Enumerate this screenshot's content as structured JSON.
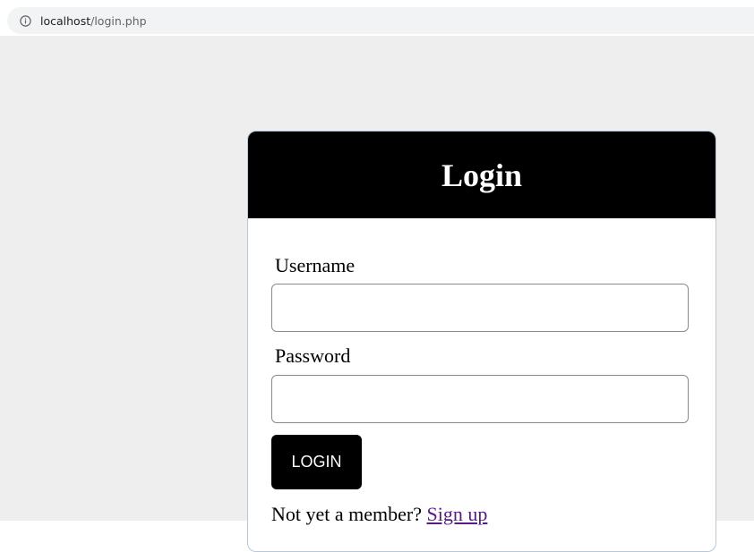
{
  "browser": {
    "url_host": "localhost",
    "url_path": "/login.php",
    "info_icon": "info-icon"
  },
  "login_form": {
    "title": "Login",
    "username_label": "Username",
    "username_value": "",
    "password_label": "Password",
    "password_value": "",
    "submit_label": "LOGIN",
    "signup_prompt": "Not yet a member?",
    "signup_link": "Sign up"
  },
  "colors": {
    "page_background": "#eeeeee",
    "header_background": "#000000",
    "button_background": "#000000",
    "link_color": "#551a8b"
  }
}
